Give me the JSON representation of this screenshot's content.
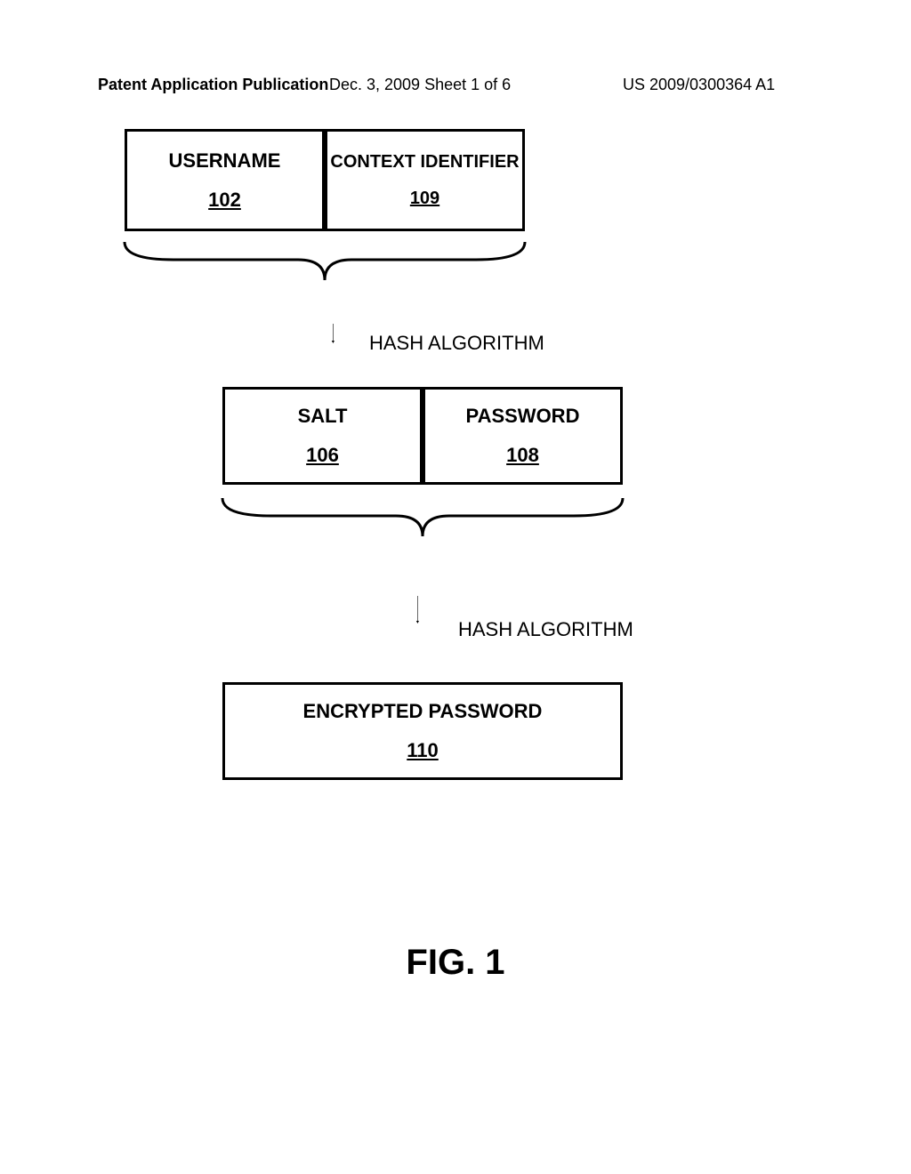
{
  "header": {
    "left": "Patent Application Publication",
    "center": "Dec. 3, 2009   Sheet 1 of 6",
    "right": "US 2009/0300364 A1"
  },
  "boxes": {
    "b1": {
      "title": "USERNAME",
      "ref": "102"
    },
    "b2": {
      "title": "CONTEXT IDENTIFIER",
      "ref": "109"
    },
    "b3": {
      "title": "SALT",
      "ref": "106"
    },
    "b4": {
      "title": "PASSWORD",
      "ref": "108"
    },
    "b5": {
      "title": "ENCRYPTED PASSWORD",
      "ref": "110"
    }
  },
  "labels": {
    "hash1": "HASH ALGORITHM",
    "hash2": "HASH ALGORITHM"
  },
  "figure": "FIG. 1"
}
